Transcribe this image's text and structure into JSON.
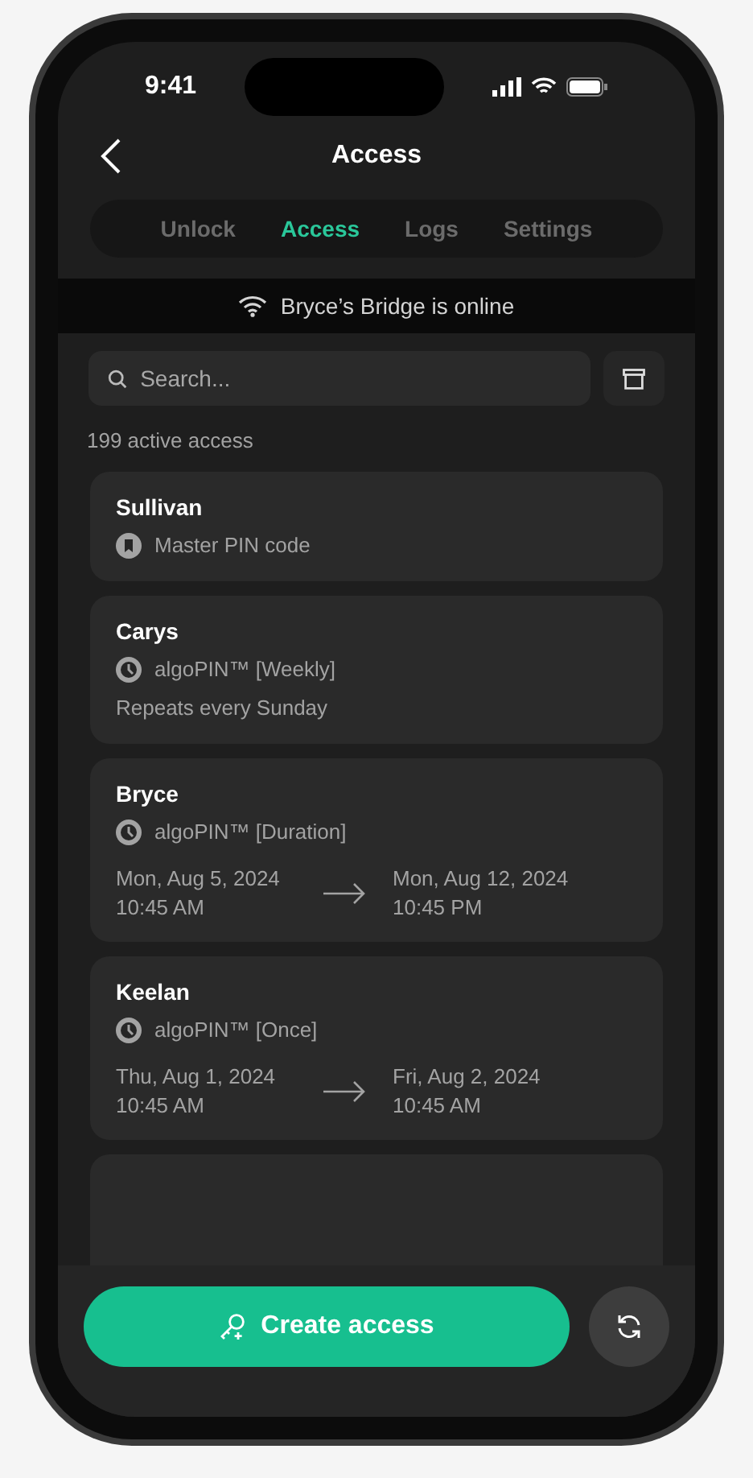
{
  "status_bar": {
    "time": "9:41"
  },
  "header": {
    "title": "Access"
  },
  "tabs": [
    {
      "label": "Unlock",
      "selected": false
    },
    {
      "label": "Access",
      "selected": true
    },
    {
      "label": "Logs",
      "selected": false
    },
    {
      "label": "Settings",
      "selected": false
    }
  ],
  "banner": {
    "text": "Bryce’s Bridge is online",
    "online": true
  },
  "search": {
    "placeholder": "Search..."
  },
  "count": "199 active access",
  "accesses": [
    {
      "name": "Sullivan",
      "kind": "master",
      "type": "Master PIN code"
    },
    {
      "name": "Carys",
      "kind": "weekly",
      "type": "algoPIN™ [Weekly]",
      "note": "Repeats every Sunday"
    },
    {
      "name": "Bryce",
      "kind": "range",
      "type": "algoPIN™ [Duration]",
      "from_date": "Mon, Aug 5, 2024",
      "from_time": "10:45 AM",
      "to_date": "Mon, Aug 12, 2024",
      "to_time": "10:45 PM"
    },
    {
      "name": "Keelan",
      "kind": "range",
      "type": "algoPIN™ [Once]",
      "from_date": "Thu, Aug 1, 2024",
      "from_time": "10:45 AM",
      "to_date": "Fri, Aug 2, 2024",
      "to_time": "10:45 AM"
    }
  ],
  "create_button": {
    "label": "Create access"
  }
}
